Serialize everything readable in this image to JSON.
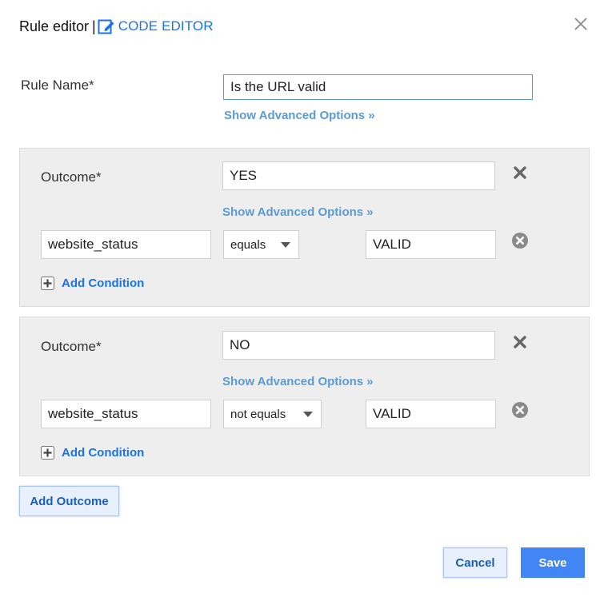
{
  "dialog": {
    "title": "Rule editor",
    "separator": "|",
    "code_editor_label": "CODE EDITOR",
    "close_icon": "close-icon"
  },
  "rule": {
    "name_label": "Rule Name*",
    "name_value": "Is the URL valid",
    "advanced_link": "Show Advanced Options »"
  },
  "outcomes": [
    {
      "label": "Outcome*",
      "value": "YES",
      "advanced_link": "Show Advanced Options »",
      "condition": {
        "field": "website_status",
        "operator": "equals",
        "value": "VALID"
      },
      "add_condition_label": "Add Condition"
    },
    {
      "label": "Outcome*",
      "value": "NO",
      "advanced_link": "Show Advanced Options »",
      "condition": {
        "field": "website_status",
        "operator": "not equals",
        "value": "VALID"
      },
      "add_condition_label": "Add Condition"
    }
  ],
  "actions": {
    "add_outcome_label": "Add Outcome",
    "cancel_label": "Cancel",
    "save_label": "Save"
  },
  "colors": {
    "accent": "#1a73e8",
    "link": "#5b9bd5",
    "primary_button": "#4285f4",
    "panel_bg": "#eeeeee"
  }
}
